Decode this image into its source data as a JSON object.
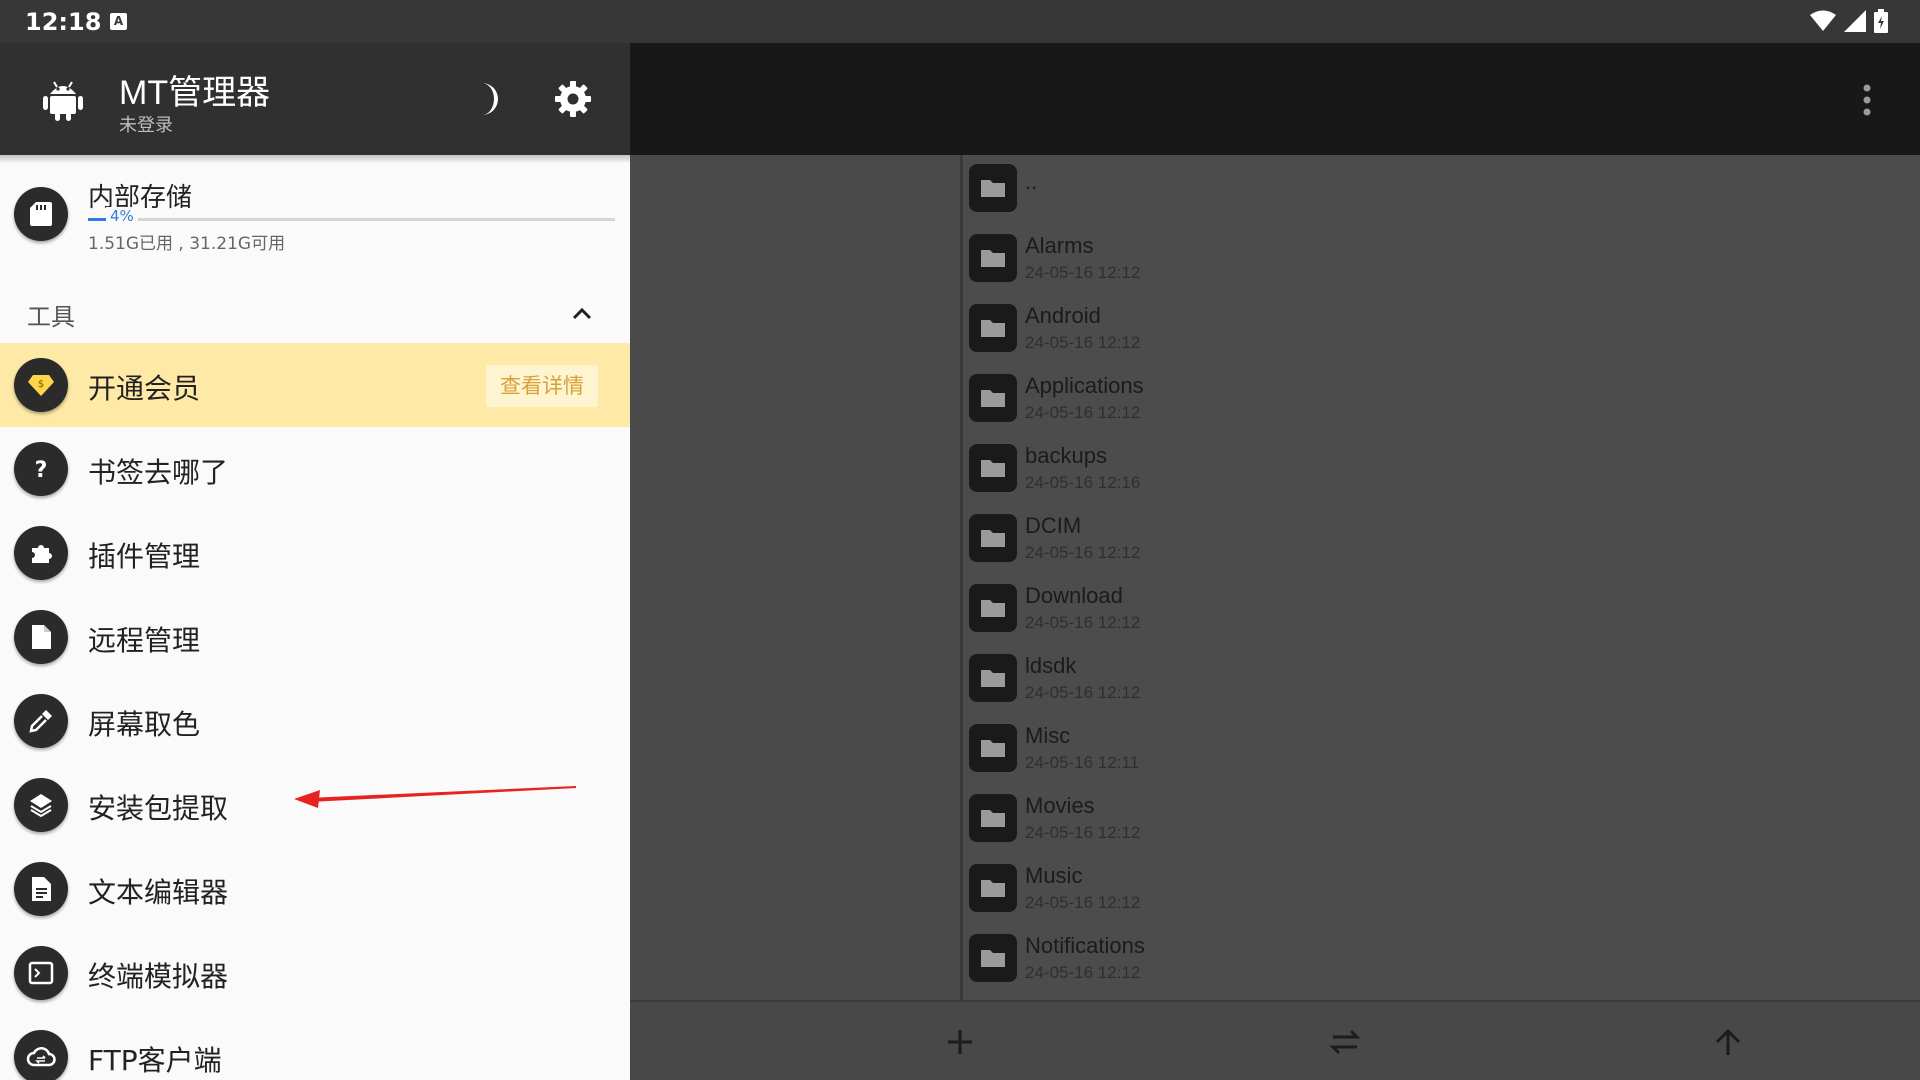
{
  "status_bar": {
    "time": "12:18",
    "notif_glyph": "A"
  },
  "drawer": {
    "app_title": "MT管理器",
    "login_status": "未登录",
    "storage": {
      "title": "内部存储",
      "percent_label": "4%",
      "used_fraction": 0.04,
      "usage": "1.51G已用 , 31.21G可用"
    },
    "tools_section": {
      "label": "工具"
    },
    "items": [
      {
        "label": "开通会员",
        "icon": "vip-diamond-icon",
        "highlight": true,
        "action": "查看详情"
      },
      {
        "label": "书签去哪了",
        "icon": "question-icon"
      },
      {
        "label": "插件管理",
        "icon": "puzzle-icon"
      },
      {
        "label": "远程管理",
        "icon": "document-icon"
      },
      {
        "label": "屏幕取色",
        "icon": "eyedropper-icon"
      },
      {
        "label": "安装包提取",
        "icon": "layers-icon"
      },
      {
        "label": "文本编辑器",
        "icon": "text-file-icon"
      },
      {
        "label": "终端模拟器",
        "icon": "terminal-icon"
      },
      {
        "label": "FTP客户端",
        "icon": "cloud-sync-icon"
      }
    ]
  },
  "file_list": [
    {
      "name": "..",
      "date": ""
    },
    {
      "name": "Alarms",
      "date": "24-05-16 12:12"
    },
    {
      "name": "Android",
      "date": "24-05-16 12:12"
    },
    {
      "name": "Applications",
      "date": "24-05-16 12:12"
    },
    {
      "name": "backups",
      "date": "24-05-16 12:16"
    },
    {
      "name": "DCIM",
      "date": "24-05-16 12:12"
    },
    {
      "name": "Download",
      "date": "24-05-16 12:12"
    },
    {
      "name": "ldsdk",
      "date": "24-05-16 12:12"
    },
    {
      "name": "Misc",
      "date": "24-05-16 12:11"
    },
    {
      "name": "Movies",
      "date": "24-05-16 12:12"
    },
    {
      "name": "Music",
      "date": "24-05-16 12:12"
    },
    {
      "name": "Notifications",
      "date": "24-05-16 12:12"
    }
  ],
  "colors": {
    "accent_blue": "#2f7de1",
    "vip_highlight": "#ffe9a6",
    "vip_text": "#d9a13a",
    "annotation_arrow": "#e8231f"
  }
}
